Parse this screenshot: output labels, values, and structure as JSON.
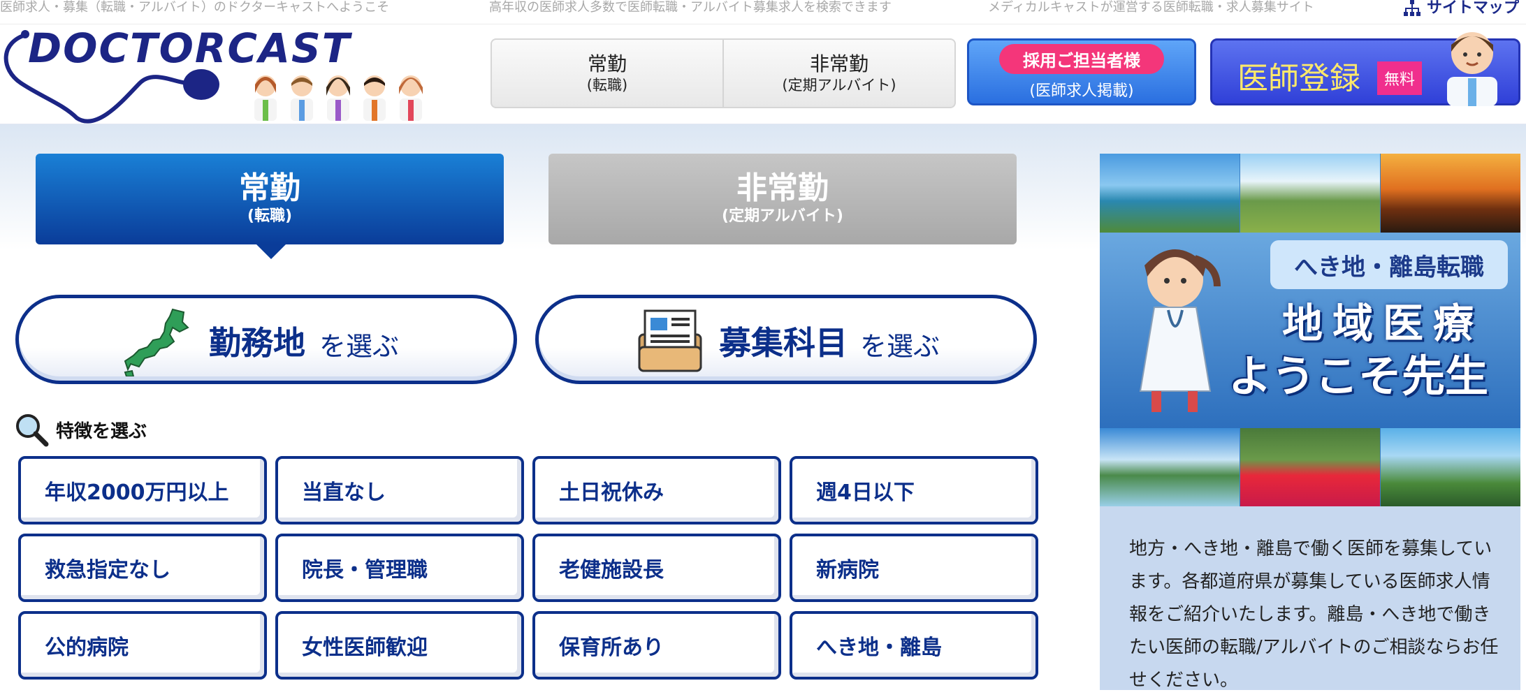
{
  "taglines": [
    "医師求人・募集（転職・アルバイト）のドクターキャストへようこそ",
    "高年収の医師求人多数で医師転職・アルバイト募集求人を検索できます",
    "メディカルキャストが運営する医師転職・求人募集サイト"
  ],
  "sitemap_label": "サイトマップ",
  "logo_text": "DOCTORCAST",
  "header_nav": [
    {
      "main": "常勤",
      "sub": "(転職)"
    },
    {
      "main": "非常勤",
      "sub": "(定期アルバイト)"
    }
  ],
  "recruiter": {
    "main": "採用ご担当者様",
    "sub": "(医師求人掲載)"
  },
  "register": {
    "label": "医師登録",
    "badge": "無料"
  },
  "category_tabs": [
    {
      "main": "常勤",
      "sub": "(転職)",
      "active": true
    },
    {
      "main": "非常勤",
      "sub": "(定期アルバイト)",
      "active": false
    }
  ],
  "select_buttons": [
    {
      "big": "勤務地",
      "small": "を選ぶ",
      "icon": "japan-map-icon"
    },
    {
      "big": "募集科目",
      "small": "を選ぶ",
      "icon": "document-folder-icon"
    }
  ],
  "feature_heading": "特徴を選ぶ",
  "features": [
    "年収2000万円以上",
    "当直なし",
    "土日祝休み",
    "週4日以下",
    "救急指定なし",
    "院長・管理職",
    "老健施設長",
    "新病院",
    "公的病院",
    "女性医師歓迎",
    "保育所あり",
    "へき地・離島"
  ],
  "banner": {
    "sub": "へき地・離島転職",
    "main1": "地域医療",
    "main2": "ようこそ先生"
  },
  "sidebar_description": "地方・へき地・離島で働く医師を募集しています。各都道府県が募集している医師求人情報をご紹介いたします。離島・へき地で働きたい医師の転職/アルバイトのご相談ならお任せください。",
  "colors": {
    "brand_navy": "#0c2f8a",
    "tab_active": "#0a3c99",
    "recruit_pink": "#f4367a",
    "register_blue": "#3040d8",
    "register_yellow": "#ffe96a"
  }
}
